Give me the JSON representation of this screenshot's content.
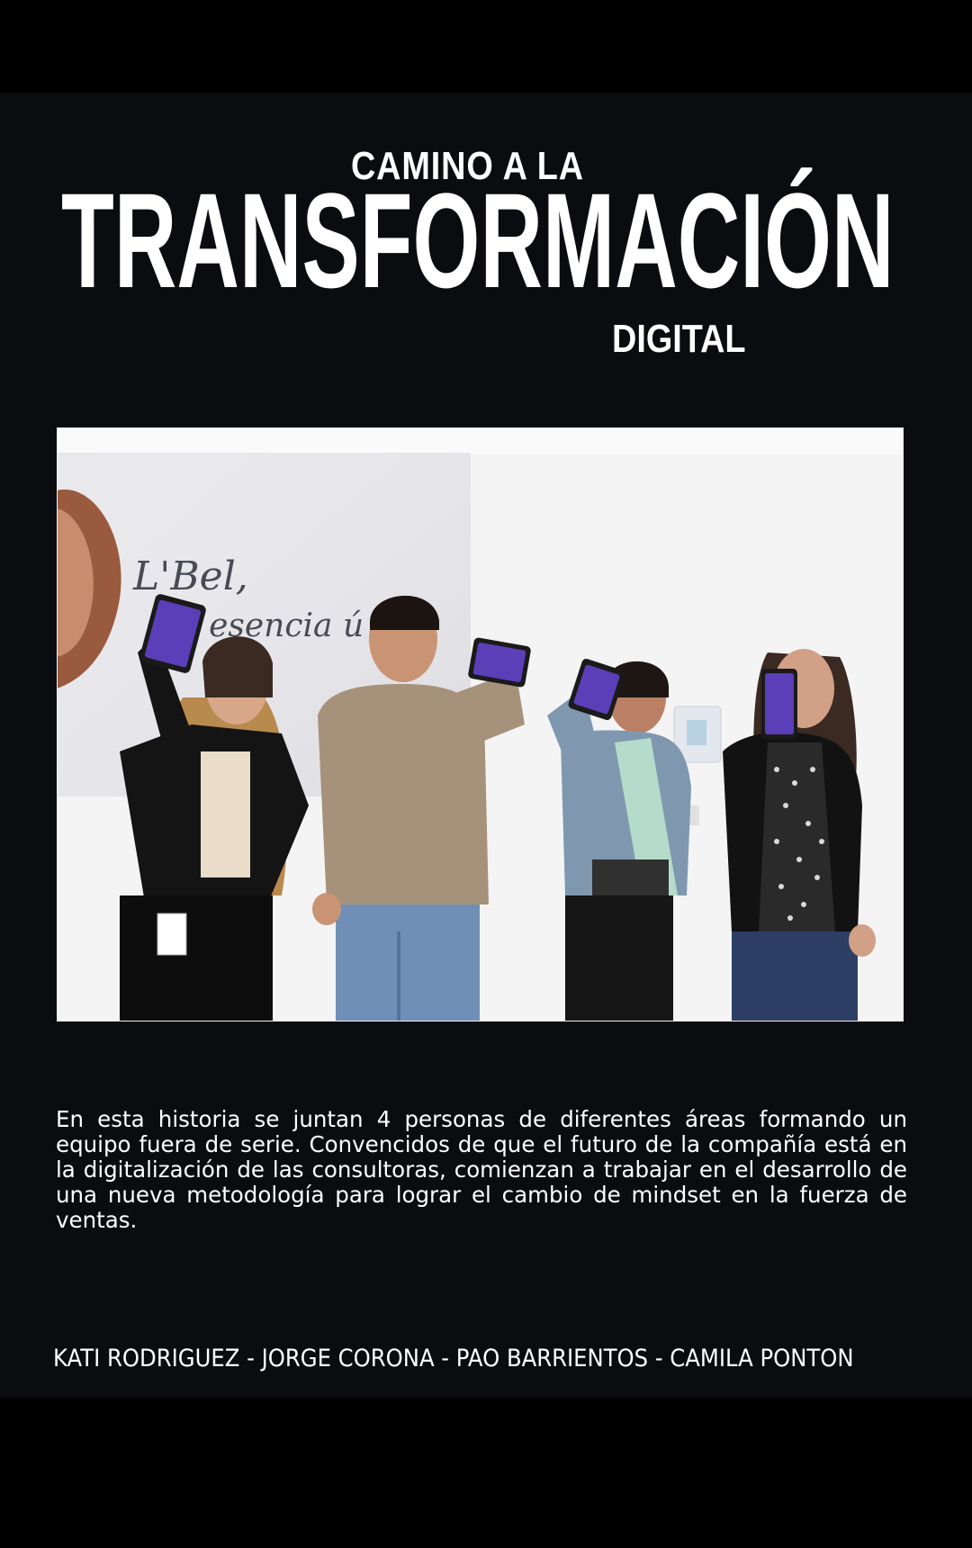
{
  "title": {
    "line1": "CAMINO A LA",
    "line2": "TRANSFORMACIÓN",
    "line3": "DIGITAL"
  },
  "photo": {
    "wall_text_line1": "L'Bel,",
    "wall_text_line2": "tu esencia ú"
  },
  "description": "En esta historia se juntan 4 personas de diferentes áreas formando un equipo fuera de serie. Convencidos de que el futuro de la compañía está en la digitalización de las consultoras, comienzan a trabajar en el desarrollo de una nueva metodología para lograr el cambio de mindset en la fuerza  de ventas.",
  "authors": "KATI RODRIGUEZ - JORGE CORONA - PAO BARRIENTOS - CAMILA PONTON",
  "colors": {
    "background": "#0b0c10",
    "text": "#ffffff",
    "phone_screen": "#5b3fb8"
  }
}
